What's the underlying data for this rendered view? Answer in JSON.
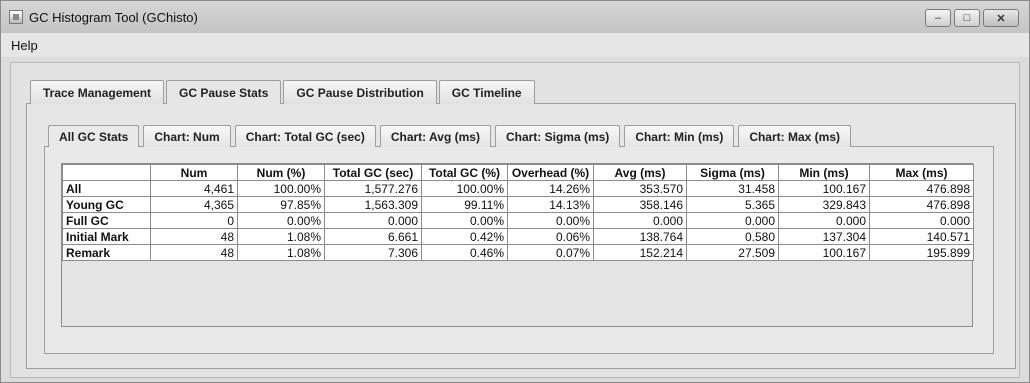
{
  "window": {
    "title": "GC Histogram Tool (GChisto)",
    "controls": {
      "minimize": "–",
      "maximize": "□",
      "close": "✕"
    }
  },
  "menubar": {
    "items": [
      "Help"
    ]
  },
  "outer_tabs": [
    {
      "label": "Trace Management",
      "active": false
    },
    {
      "label": "GC Pause Stats",
      "active": true
    },
    {
      "label": "GC Pause Distribution",
      "active": false
    },
    {
      "label": "GC Timeline",
      "active": false
    }
  ],
  "inner_tabs": [
    {
      "label": "All GC Stats",
      "active": true
    },
    {
      "label": "Chart: Num",
      "active": false
    },
    {
      "label": "Chart: Total GC (sec)",
      "active": false
    },
    {
      "label": "Chart: Avg (ms)",
      "active": false
    },
    {
      "label": "Chart: Sigma (ms)",
      "active": false
    },
    {
      "label": "Chart: Min (ms)",
      "active": false
    },
    {
      "label": "Chart: Max (ms)",
      "active": false
    }
  ],
  "table": {
    "columns": [
      "",
      "Num",
      "Num (%)",
      "Total GC (sec)",
      "Total GC (%)",
      "Overhead (%)",
      "Avg (ms)",
      "Sigma (ms)",
      "Min (ms)",
      "Max (ms)"
    ],
    "rows": [
      [
        "All",
        "4,461",
        "100.00%",
        "1,577.276",
        "100.00%",
        "14.26%",
        "353.570",
        "31.458",
        "100.167",
        "476.898"
      ],
      [
        "Young GC",
        "4,365",
        "97.85%",
        "1,563.309",
        "99.11%",
        "14.13%",
        "358.146",
        "5.365",
        "329.843",
        "476.898"
      ],
      [
        "Full GC",
        "0",
        "0.00%",
        "0.000",
        "0.00%",
        "0.00%",
        "0.000",
        "0.000",
        "0.000",
        "0.000"
      ],
      [
        "Initial Mark",
        "48",
        "1.08%",
        "6.661",
        "0.42%",
        "0.06%",
        "138.764",
        "0.580",
        "137.304",
        "140.571"
      ],
      [
        "Remark",
        "48",
        "1.08%",
        "7.306",
        "0.46%",
        "0.07%",
        "152.214",
        "27.509",
        "100.167",
        "195.899"
      ]
    ]
  }
}
